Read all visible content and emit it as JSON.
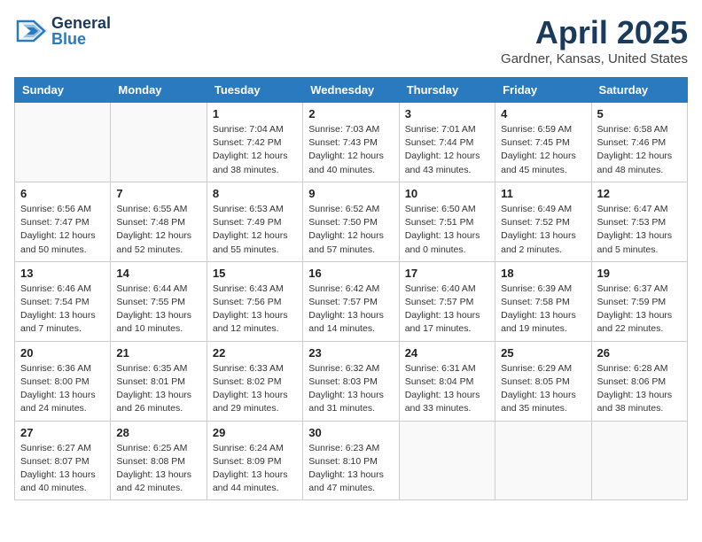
{
  "header": {
    "logo_general": "General",
    "logo_blue": "Blue",
    "month_title": "April 2025",
    "location": "Gardner, Kansas, United States"
  },
  "weekdays": [
    "Sunday",
    "Monday",
    "Tuesday",
    "Wednesday",
    "Thursday",
    "Friday",
    "Saturday"
  ],
  "weeks": [
    [
      {
        "day": "",
        "info": ""
      },
      {
        "day": "",
        "info": ""
      },
      {
        "day": "1",
        "info": "Sunrise: 7:04 AM\nSunset: 7:42 PM\nDaylight: 12 hours\nand 38 minutes."
      },
      {
        "day": "2",
        "info": "Sunrise: 7:03 AM\nSunset: 7:43 PM\nDaylight: 12 hours\nand 40 minutes."
      },
      {
        "day": "3",
        "info": "Sunrise: 7:01 AM\nSunset: 7:44 PM\nDaylight: 12 hours\nand 43 minutes."
      },
      {
        "day": "4",
        "info": "Sunrise: 6:59 AM\nSunset: 7:45 PM\nDaylight: 12 hours\nand 45 minutes."
      },
      {
        "day": "5",
        "info": "Sunrise: 6:58 AM\nSunset: 7:46 PM\nDaylight: 12 hours\nand 48 minutes."
      }
    ],
    [
      {
        "day": "6",
        "info": "Sunrise: 6:56 AM\nSunset: 7:47 PM\nDaylight: 12 hours\nand 50 minutes."
      },
      {
        "day": "7",
        "info": "Sunrise: 6:55 AM\nSunset: 7:48 PM\nDaylight: 12 hours\nand 52 minutes."
      },
      {
        "day": "8",
        "info": "Sunrise: 6:53 AM\nSunset: 7:49 PM\nDaylight: 12 hours\nand 55 minutes."
      },
      {
        "day": "9",
        "info": "Sunrise: 6:52 AM\nSunset: 7:50 PM\nDaylight: 12 hours\nand 57 minutes."
      },
      {
        "day": "10",
        "info": "Sunrise: 6:50 AM\nSunset: 7:51 PM\nDaylight: 13 hours\nand 0 minutes."
      },
      {
        "day": "11",
        "info": "Sunrise: 6:49 AM\nSunset: 7:52 PM\nDaylight: 13 hours\nand 2 minutes."
      },
      {
        "day": "12",
        "info": "Sunrise: 6:47 AM\nSunset: 7:53 PM\nDaylight: 13 hours\nand 5 minutes."
      }
    ],
    [
      {
        "day": "13",
        "info": "Sunrise: 6:46 AM\nSunset: 7:54 PM\nDaylight: 13 hours\nand 7 minutes."
      },
      {
        "day": "14",
        "info": "Sunrise: 6:44 AM\nSunset: 7:55 PM\nDaylight: 13 hours\nand 10 minutes."
      },
      {
        "day": "15",
        "info": "Sunrise: 6:43 AM\nSunset: 7:56 PM\nDaylight: 13 hours\nand 12 minutes."
      },
      {
        "day": "16",
        "info": "Sunrise: 6:42 AM\nSunset: 7:57 PM\nDaylight: 13 hours\nand 14 minutes."
      },
      {
        "day": "17",
        "info": "Sunrise: 6:40 AM\nSunset: 7:57 PM\nDaylight: 13 hours\nand 17 minutes."
      },
      {
        "day": "18",
        "info": "Sunrise: 6:39 AM\nSunset: 7:58 PM\nDaylight: 13 hours\nand 19 minutes."
      },
      {
        "day": "19",
        "info": "Sunrise: 6:37 AM\nSunset: 7:59 PM\nDaylight: 13 hours\nand 22 minutes."
      }
    ],
    [
      {
        "day": "20",
        "info": "Sunrise: 6:36 AM\nSunset: 8:00 PM\nDaylight: 13 hours\nand 24 minutes."
      },
      {
        "day": "21",
        "info": "Sunrise: 6:35 AM\nSunset: 8:01 PM\nDaylight: 13 hours\nand 26 minutes."
      },
      {
        "day": "22",
        "info": "Sunrise: 6:33 AM\nSunset: 8:02 PM\nDaylight: 13 hours\nand 29 minutes."
      },
      {
        "day": "23",
        "info": "Sunrise: 6:32 AM\nSunset: 8:03 PM\nDaylight: 13 hours\nand 31 minutes."
      },
      {
        "day": "24",
        "info": "Sunrise: 6:31 AM\nSunset: 8:04 PM\nDaylight: 13 hours\nand 33 minutes."
      },
      {
        "day": "25",
        "info": "Sunrise: 6:29 AM\nSunset: 8:05 PM\nDaylight: 13 hours\nand 35 minutes."
      },
      {
        "day": "26",
        "info": "Sunrise: 6:28 AM\nSunset: 8:06 PM\nDaylight: 13 hours\nand 38 minutes."
      }
    ],
    [
      {
        "day": "27",
        "info": "Sunrise: 6:27 AM\nSunset: 8:07 PM\nDaylight: 13 hours\nand 40 minutes."
      },
      {
        "day": "28",
        "info": "Sunrise: 6:25 AM\nSunset: 8:08 PM\nDaylight: 13 hours\nand 42 minutes."
      },
      {
        "day": "29",
        "info": "Sunrise: 6:24 AM\nSunset: 8:09 PM\nDaylight: 13 hours\nand 44 minutes."
      },
      {
        "day": "30",
        "info": "Sunrise: 6:23 AM\nSunset: 8:10 PM\nDaylight: 13 hours\nand 47 minutes."
      },
      {
        "day": "",
        "info": ""
      },
      {
        "day": "",
        "info": ""
      },
      {
        "day": "",
        "info": ""
      }
    ]
  ]
}
